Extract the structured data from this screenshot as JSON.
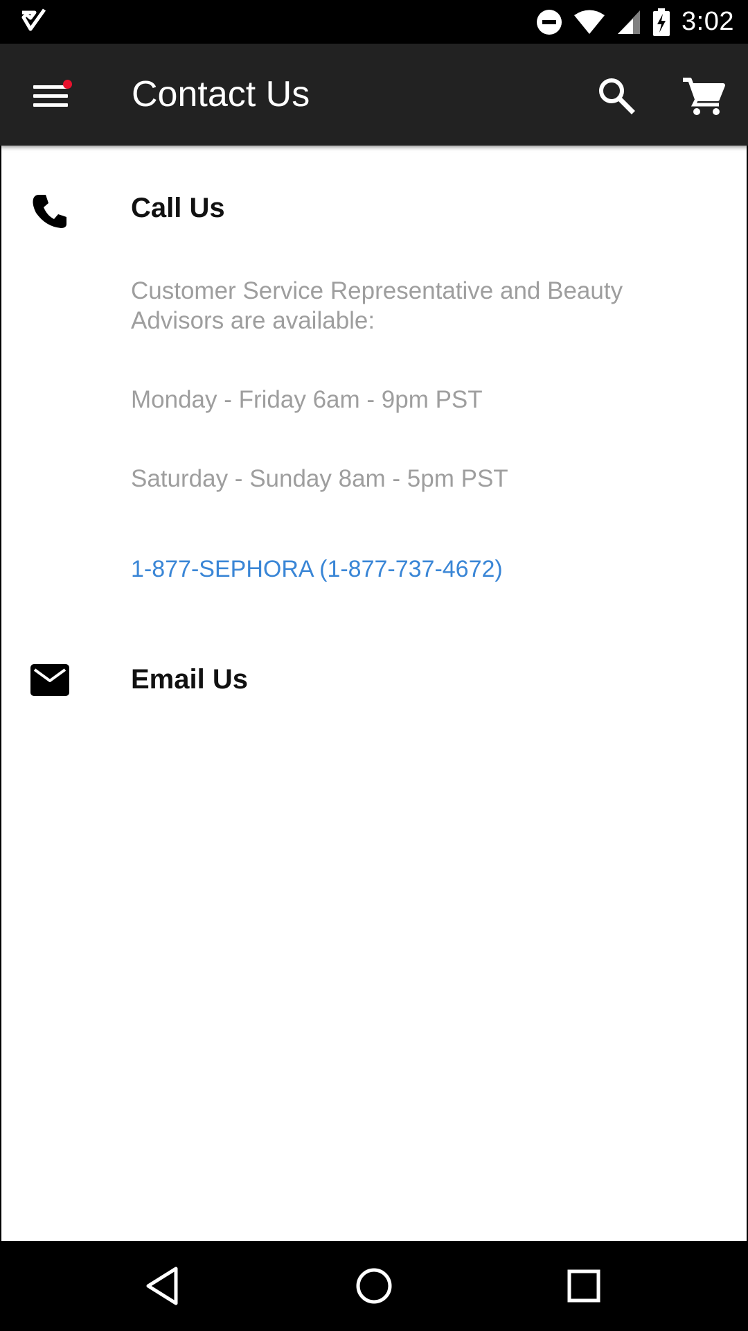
{
  "status_bar": {
    "time": "3:02",
    "icons": [
      "notification-check-icon",
      "do-not-disturb-icon",
      "wifi-icon",
      "signal-icon",
      "battery-charging-icon"
    ]
  },
  "app_bar": {
    "title": "Contact Us",
    "icons": [
      "menu-icon",
      "search-icon",
      "cart-icon"
    ],
    "notification_dot_color": "#e8112d"
  },
  "call_section": {
    "heading": "Call Us",
    "availability": "Customer Service Representative and Beauty Advisors are available:",
    "weekday_hours": "Monday - Friday 6am - 9pm PST",
    "weekend_hours": "Saturday - Sunday 8am - 5pm PST",
    "phone": "1-877-SEPHORA (1-877-737-4672)",
    "link_color": "#3a86d6"
  },
  "email_section": {
    "heading": "Email Us"
  },
  "nav_bar": {
    "icons": [
      "back-icon",
      "home-icon",
      "recents-icon"
    ]
  }
}
